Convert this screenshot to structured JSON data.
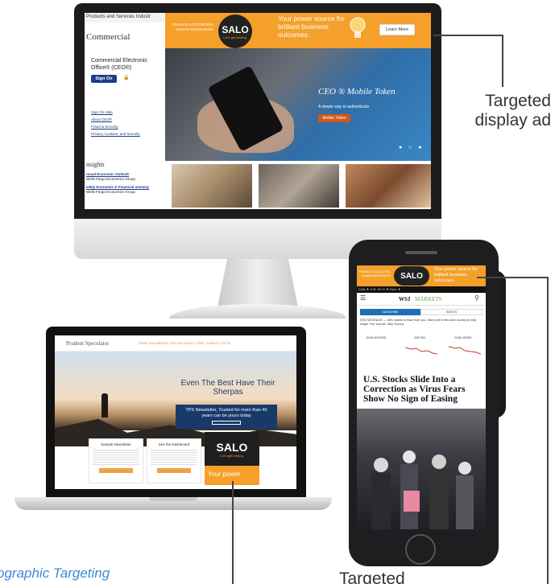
{
  "callouts": {
    "desktop_line1": "Targeted",
    "desktop_line2": "display ad",
    "bottom_targeted": "Targeted",
    "demographic": "ographic Targeting"
  },
  "desktop_site": {
    "topnav": "Products and Services   Industr",
    "brand_title": "Commercial",
    "login_title": "Commercial Electronic Office® (CEO®)",
    "sign_on": "Sign On",
    "lock_icon": "lock-icon",
    "links": [
      "Sign On Help",
      "About CEO®",
      "Fraud & Security",
      "Privacy, Cookies, and Security"
    ],
    "ad": {
      "left_text": "FINANCE ACCOUNTING HUMAN RESOURCES",
      "logo": "SALO",
      "logo_sub": "Let's get solving.",
      "main_text": "Your power source for brilliant business outcomes.",
      "learn_more": "Learn More"
    },
    "hero": {
      "title": "CEO ® Mobile Token",
      "subtitle": "A simple way to authenticate",
      "button": "Mobile Token",
      "dots": "● ○ ●"
    },
    "insights_title": "nsights",
    "insights": [
      {
        "link": "nnual Economic Outlook",
        "src": "Wells Fargo Economics Group"
      },
      {
        "link": "eekly Economic & Financial mentary",
        "src": "Wells Fargo Economics Group"
      }
    ]
  },
  "laptop_site": {
    "logo": "Prudent Speculator",
    "menu": "HOME   DASHBOARD   PRICING   ABOUT   FREE SAMPLE   LOG IN",
    "headline": "Even The Best Have Their Sherpas",
    "box_text": "TPS Newsletter, Trusted for more than 40 years can be yours today",
    "cards": [
      "Sample Newsletter",
      "See the Dashboard"
    ],
    "ad_logo": "SALO",
    "ad_logo_sub": "Let's get solving.",
    "ad_text": "Your power"
  },
  "phone_site": {
    "ad_left": "FINANCE ACCOUNTING HUMAN RESOURCES",
    "ad_logo": "SALO",
    "ad_right": "Your power source for brilliant business outcomes.",
    "ticker": "DJIA ▼     U.S. 10 Yr ▼       Euro ▼",
    "menu_icon": "hamburger-icon",
    "logo": "WSJ",
    "section": "MARKETS",
    "search_icon": "search-icon",
    "subscribe": "SUBSCRIBE",
    "sign_in": "SIGN IN",
    "message": "WSJ MESSAGE — WSJ wants to hear from you. Take part in this short survey to help shape The Journal. Take Survey",
    "charts": [
      "DOW MOVERS",
      "S&P 500",
      "DOW JONES"
    ],
    "headline": "U.S. Stocks Slide Into a Correction as Virus Fears Show No Sign of Easing"
  }
}
